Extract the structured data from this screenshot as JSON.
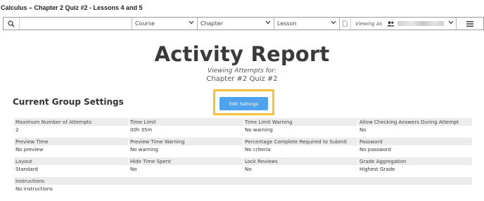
{
  "window": {
    "title": "Calculus – Chapter 2 Quiz #2 - Lessons 4 and 5"
  },
  "toolbar": {
    "search_placeholder": "",
    "course": "Course",
    "chapter": "Chapter",
    "lesson": "Lesson",
    "viewing_as": "Viewing As"
  },
  "report": {
    "title": "Activity Report",
    "viewing_for": "Viewing Attempts for:",
    "quiz_name": "Chapter #2 Quiz #2"
  },
  "settings": {
    "heading": "Current Group Settings",
    "edit_label": "Edit Settings",
    "rows": [
      [
        {
          "label": "Maximum Number of Attempts",
          "value": "2"
        },
        {
          "label": "Time Limit",
          "value": "00h 35m"
        },
        {
          "label": "Time Limit Warning",
          "value": "No warning"
        },
        {
          "label": "Allow Checking Answers During Attempt",
          "value": "No"
        }
      ],
      [
        {
          "label": "Preview Time",
          "value": "No preview"
        },
        {
          "label": "Preview Time Warning",
          "value": "No warning"
        },
        {
          "label": "Percentage Complete Required to Submit",
          "value": "No criteria"
        },
        {
          "label": "Password",
          "value": "No password"
        }
      ],
      [
        {
          "label": "Layout",
          "value": "Standard"
        },
        {
          "label": "Hide Time Spent",
          "value": "No"
        },
        {
          "label": "Lock Reviews",
          "value": "No"
        },
        {
          "label": "Grade Aggregation",
          "value": "Highest Grade"
        }
      ]
    ],
    "instructions": {
      "label": "Instructions",
      "value": "No instructions"
    }
  }
}
